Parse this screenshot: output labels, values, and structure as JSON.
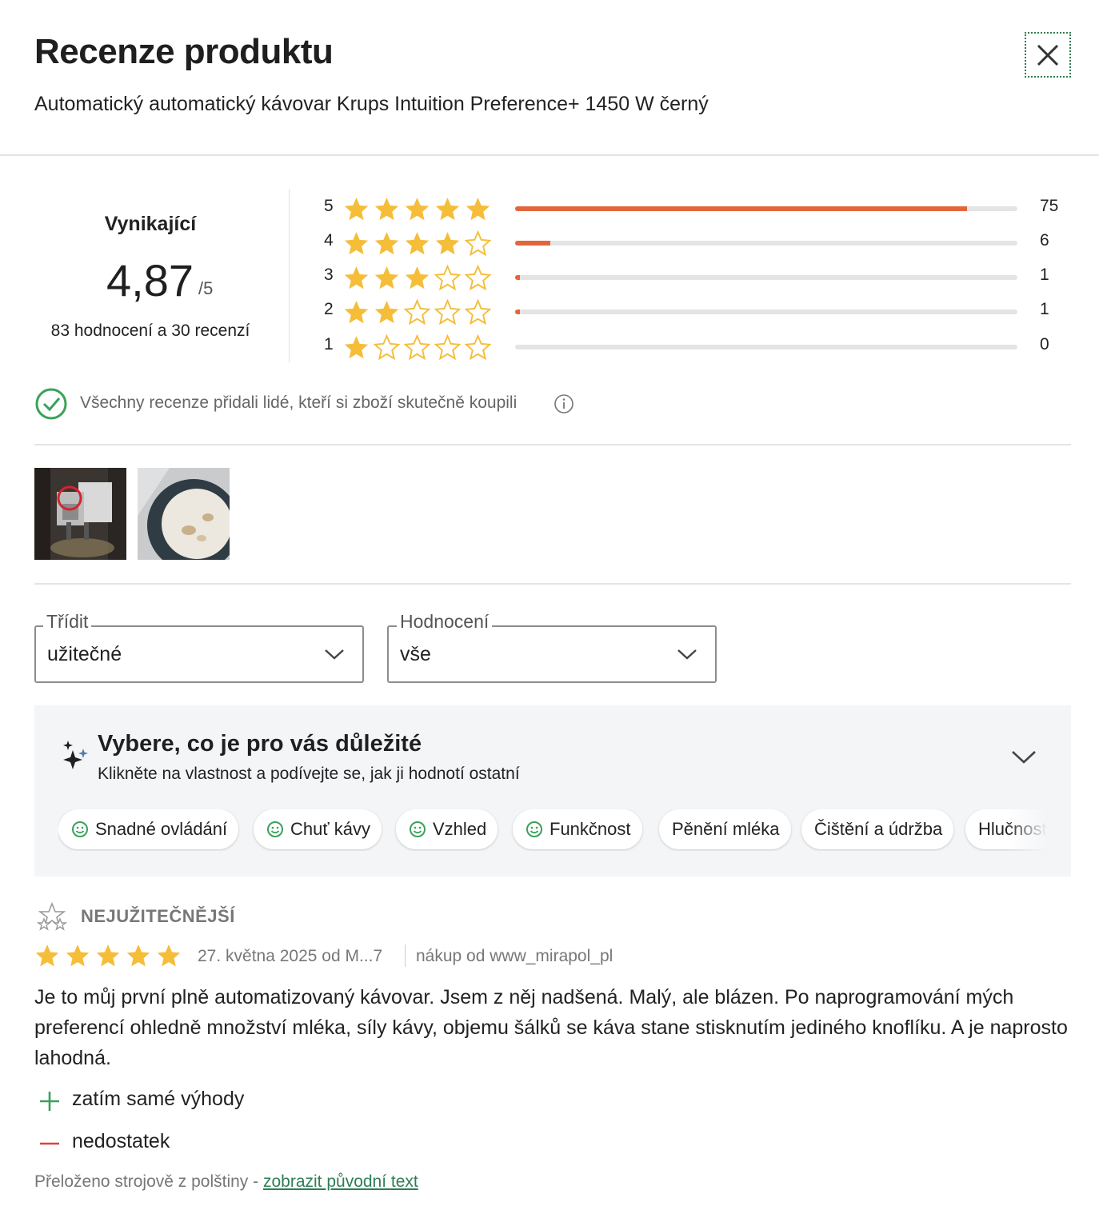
{
  "header": {
    "title": "Recenze produktu",
    "product_name": "Automatický automatický kávovar Krups Intuition Preference+ 1450 W černý",
    "close_icon": "close-icon"
  },
  "summary": {
    "verdict": "Vynikající",
    "score": "4,87",
    "score_max": "/5",
    "counts": "83 hodnocení a 30 recenzí"
  },
  "distribution": [
    {
      "stars": "5",
      "filled": 5,
      "count": "75",
      "fraction": 0.9
    },
    {
      "stars": "4",
      "filled": 4,
      "count": "6",
      "fraction": 0.07
    },
    {
      "stars": "3",
      "filled": 3,
      "count": "1",
      "fraction": 0.01
    },
    {
      "stars": "2",
      "filled": 2,
      "count": "1",
      "fraction": 0.01
    },
    {
      "stars": "1",
      "filled": 1,
      "count": "0",
      "fraction": 0.0
    }
  ],
  "verified": {
    "text": "Všechny recenze přidali lidé, kteří si zboží skutečně koupili",
    "icon": "check-circle-icon"
  },
  "filters": {
    "sort_label": "Třídit",
    "sort_value": "užitečné",
    "rating_label": "Hodnocení",
    "rating_value": "vše"
  },
  "important": {
    "title": "Vybere, co je pro vás důležité",
    "subtitle": "Klikněte na vlastnost a podívejte se, jak ji hodnotí ostatní",
    "chips": [
      {
        "label": "Snadné ovládání",
        "smiley": true
      },
      {
        "label": "Chuť kávy",
        "smiley": true
      },
      {
        "label": "Vzhled",
        "smiley": true
      },
      {
        "label": "Funkčnost",
        "smiley": true
      },
      {
        "label": "Pěnění mléka",
        "smiley": false
      },
      {
        "label": "Čištění a údržba",
        "smiley": false
      },
      {
        "label": "Hlučnost",
        "smiley": false
      }
    ]
  },
  "review": {
    "badge": "NEJUŽITEČNĚJŠÍ",
    "rating": 5,
    "date_author": "27. května 2025 od M...7",
    "shop": "nákup od www_mirapol_pl",
    "text": "Je to můj první plně automatizovaný kávovar. Jsem z něj nadšená. Malý, ale blázen. Po naprogramování mých preferencí ohledně množství mléka, síly kávy, objemu šálků se káva stane stisknutím jediného knoflíku. A je naprosto lahodná.",
    "pro": "zatím samé výhody",
    "con": "nedostatek",
    "translated_note": "Přeloženo strojově z polštiny - ",
    "original_link": "zobrazit původní text"
  },
  "colors": {
    "star": "#f5bd38",
    "bar_fill": "#e2663b",
    "bar_track": "#e4e4e4",
    "accent_green": "#3aa15a",
    "link_green": "#2f7d57",
    "con_red": "#e0423a"
  }
}
